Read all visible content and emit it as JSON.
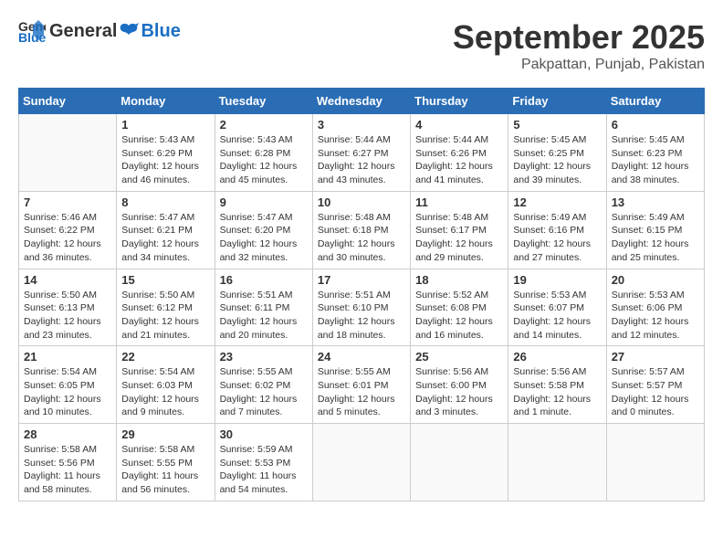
{
  "header": {
    "logo_general": "General",
    "logo_blue": "Blue",
    "month": "September 2025",
    "location": "Pakpattan, Punjab, Pakistan"
  },
  "weekdays": [
    "Sunday",
    "Monday",
    "Tuesday",
    "Wednesday",
    "Thursday",
    "Friday",
    "Saturday"
  ],
  "weeks": [
    [
      {
        "day": "",
        "info": ""
      },
      {
        "day": "1",
        "info": "Sunrise: 5:43 AM\nSunset: 6:29 PM\nDaylight: 12 hours\nand 46 minutes."
      },
      {
        "day": "2",
        "info": "Sunrise: 5:43 AM\nSunset: 6:28 PM\nDaylight: 12 hours\nand 45 minutes."
      },
      {
        "day": "3",
        "info": "Sunrise: 5:44 AM\nSunset: 6:27 PM\nDaylight: 12 hours\nand 43 minutes."
      },
      {
        "day": "4",
        "info": "Sunrise: 5:44 AM\nSunset: 6:26 PM\nDaylight: 12 hours\nand 41 minutes."
      },
      {
        "day": "5",
        "info": "Sunrise: 5:45 AM\nSunset: 6:25 PM\nDaylight: 12 hours\nand 39 minutes."
      },
      {
        "day": "6",
        "info": "Sunrise: 5:45 AM\nSunset: 6:23 PM\nDaylight: 12 hours\nand 38 minutes."
      }
    ],
    [
      {
        "day": "7",
        "info": "Sunrise: 5:46 AM\nSunset: 6:22 PM\nDaylight: 12 hours\nand 36 minutes."
      },
      {
        "day": "8",
        "info": "Sunrise: 5:47 AM\nSunset: 6:21 PM\nDaylight: 12 hours\nand 34 minutes."
      },
      {
        "day": "9",
        "info": "Sunrise: 5:47 AM\nSunset: 6:20 PM\nDaylight: 12 hours\nand 32 minutes."
      },
      {
        "day": "10",
        "info": "Sunrise: 5:48 AM\nSunset: 6:18 PM\nDaylight: 12 hours\nand 30 minutes."
      },
      {
        "day": "11",
        "info": "Sunrise: 5:48 AM\nSunset: 6:17 PM\nDaylight: 12 hours\nand 29 minutes."
      },
      {
        "day": "12",
        "info": "Sunrise: 5:49 AM\nSunset: 6:16 PM\nDaylight: 12 hours\nand 27 minutes."
      },
      {
        "day": "13",
        "info": "Sunrise: 5:49 AM\nSunset: 6:15 PM\nDaylight: 12 hours\nand 25 minutes."
      }
    ],
    [
      {
        "day": "14",
        "info": "Sunrise: 5:50 AM\nSunset: 6:13 PM\nDaylight: 12 hours\nand 23 minutes."
      },
      {
        "day": "15",
        "info": "Sunrise: 5:50 AM\nSunset: 6:12 PM\nDaylight: 12 hours\nand 21 minutes."
      },
      {
        "day": "16",
        "info": "Sunrise: 5:51 AM\nSunset: 6:11 PM\nDaylight: 12 hours\nand 20 minutes."
      },
      {
        "day": "17",
        "info": "Sunrise: 5:51 AM\nSunset: 6:10 PM\nDaylight: 12 hours\nand 18 minutes."
      },
      {
        "day": "18",
        "info": "Sunrise: 5:52 AM\nSunset: 6:08 PM\nDaylight: 12 hours\nand 16 minutes."
      },
      {
        "day": "19",
        "info": "Sunrise: 5:53 AM\nSunset: 6:07 PM\nDaylight: 12 hours\nand 14 minutes."
      },
      {
        "day": "20",
        "info": "Sunrise: 5:53 AM\nSunset: 6:06 PM\nDaylight: 12 hours\nand 12 minutes."
      }
    ],
    [
      {
        "day": "21",
        "info": "Sunrise: 5:54 AM\nSunset: 6:05 PM\nDaylight: 12 hours\nand 10 minutes."
      },
      {
        "day": "22",
        "info": "Sunrise: 5:54 AM\nSunset: 6:03 PM\nDaylight: 12 hours\nand 9 minutes."
      },
      {
        "day": "23",
        "info": "Sunrise: 5:55 AM\nSunset: 6:02 PM\nDaylight: 12 hours\nand 7 minutes."
      },
      {
        "day": "24",
        "info": "Sunrise: 5:55 AM\nSunset: 6:01 PM\nDaylight: 12 hours\nand 5 minutes."
      },
      {
        "day": "25",
        "info": "Sunrise: 5:56 AM\nSunset: 6:00 PM\nDaylight: 12 hours\nand 3 minutes."
      },
      {
        "day": "26",
        "info": "Sunrise: 5:56 AM\nSunset: 5:58 PM\nDaylight: 12 hours\nand 1 minute."
      },
      {
        "day": "27",
        "info": "Sunrise: 5:57 AM\nSunset: 5:57 PM\nDaylight: 12 hours\nand 0 minutes."
      }
    ],
    [
      {
        "day": "28",
        "info": "Sunrise: 5:58 AM\nSunset: 5:56 PM\nDaylight: 11 hours\nand 58 minutes."
      },
      {
        "day": "29",
        "info": "Sunrise: 5:58 AM\nSunset: 5:55 PM\nDaylight: 11 hours\nand 56 minutes."
      },
      {
        "day": "30",
        "info": "Sunrise: 5:59 AM\nSunset: 5:53 PM\nDaylight: 11 hours\nand 54 minutes."
      },
      {
        "day": "",
        "info": ""
      },
      {
        "day": "",
        "info": ""
      },
      {
        "day": "",
        "info": ""
      },
      {
        "day": "",
        "info": ""
      }
    ]
  ]
}
